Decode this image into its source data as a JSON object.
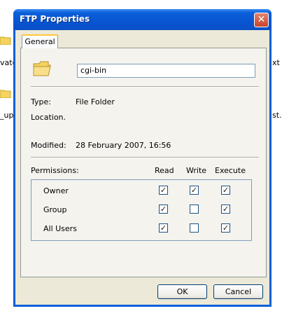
{
  "background": {
    "left_labels": [
      "vate",
      "_ups"
    ],
    "right_labels": [
      "xt",
      "st.."
    ]
  },
  "window": {
    "title": "FTP Properties",
    "close_glyph": "✕",
    "tabs": [
      {
        "label": "General",
        "active": true
      }
    ],
    "folder_name": "cgi-bin",
    "type_label": "Type:",
    "type_value": "File Folder",
    "location_label": "Location.",
    "location_value": "",
    "modified_label": "Modified:",
    "modified_value": "28 February 2007, 16:56",
    "permissions": {
      "label": "Permissions:",
      "columns": [
        "Read",
        "Write",
        "Execute"
      ],
      "rows": [
        {
          "name": "Owner",
          "read": true,
          "write": true,
          "execute": true
        },
        {
          "name": "Group",
          "read": true,
          "write": false,
          "execute": true
        },
        {
          "name": "All Users",
          "read": true,
          "write": false,
          "execute": true
        }
      ]
    },
    "buttons": {
      "ok": "OK",
      "cancel": "Cancel"
    }
  },
  "colors": {
    "titlebar": "#0a5fd8",
    "dialog_bg": "#ece9d8",
    "tab_highlight": "#ffc83c",
    "folder": "#f4d35e"
  }
}
